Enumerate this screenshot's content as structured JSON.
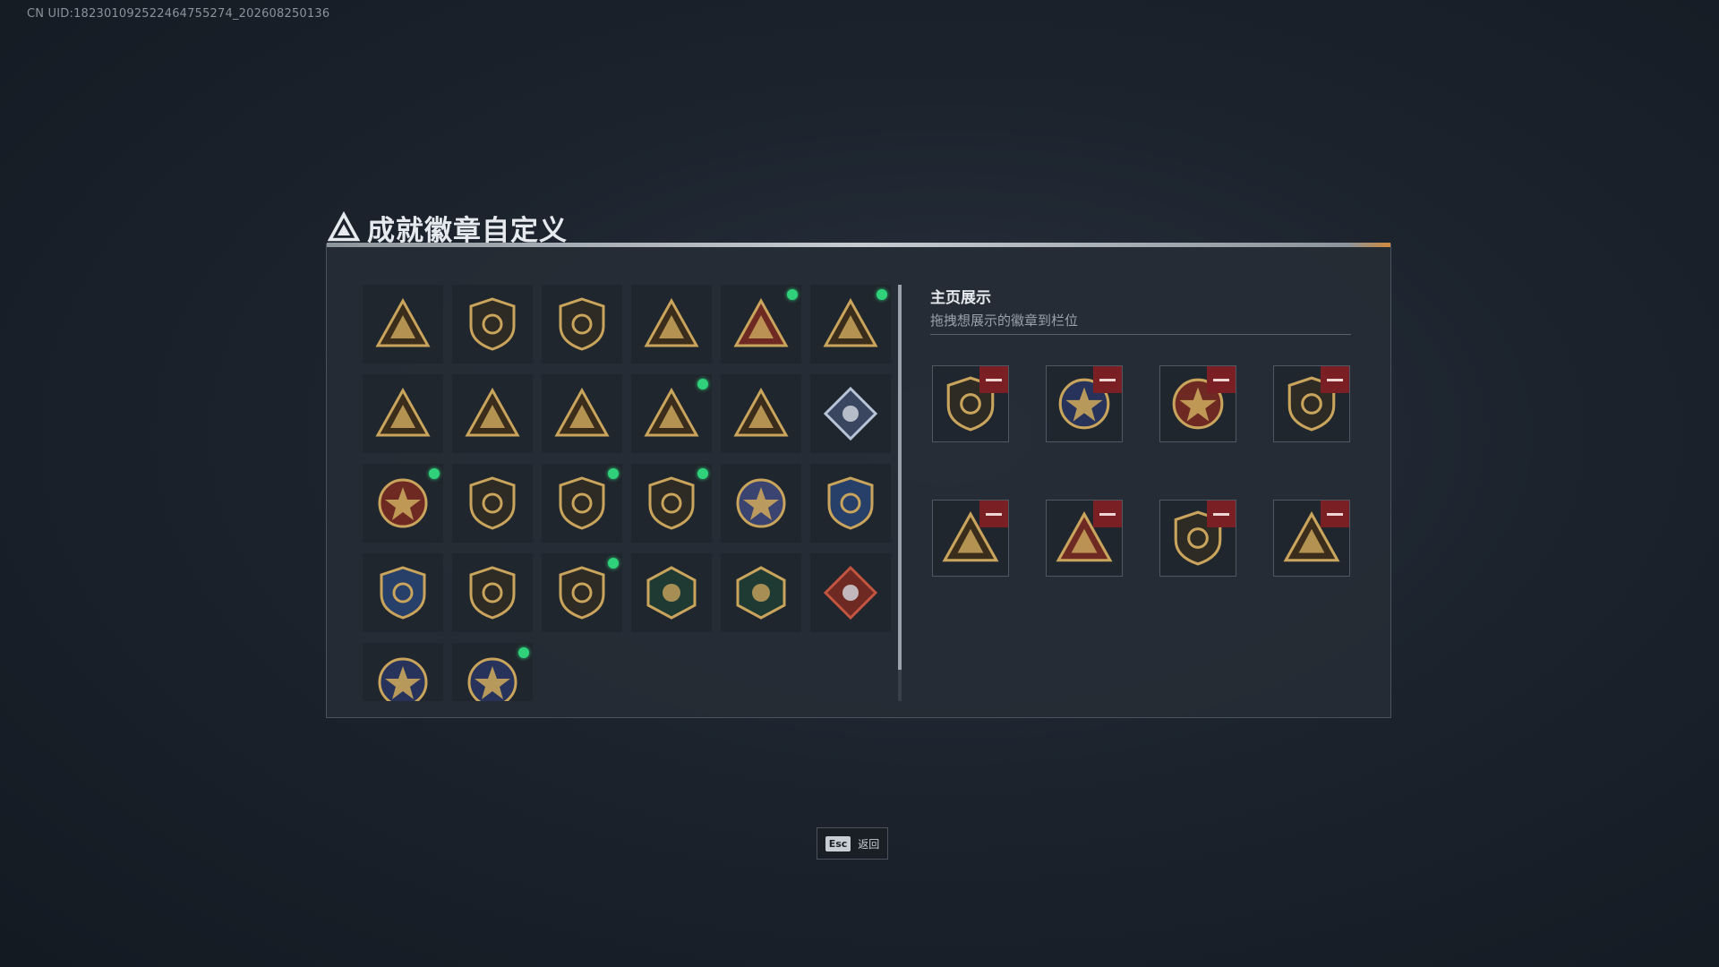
{
  "uid_text": "CN UID:182301092522464755274_202608250136",
  "title": "成就徽章自定义",
  "showcase": {
    "title": "主页展示",
    "subtitle": "拖拽想展示的徽章到栏位"
  },
  "esc": {
    "key": "Esc",
    "label": "返回"
  },
  "colors": {
    "new_dot": "#2fd17a",
    "remove_button": "#7a1f24",
    "gold": "#c9a45c",
    "navy": "#27335a",
    "dark_red": "#6e2a22"
  },
  "badges": [
    {
      "icon": "triangle-logo-badge-icon",
      "new": false
    },
    {
      "icon": "helicopter-badge-icon",
      "new": false
    },
    {
      "icon": "jet-shield-badge-icon",
      "new": false
    },
    {
      "icon": "ss-emblem-badge-icon",
      "new": false
    },
    {
      "icon": "sb-emblem-badge-icon",
      "new": true
    },
    {
      "icon": "star-emblem-badge-icon",
      "new": true
    },
    {
      "icon": "helmet-triangle-badge-icon",
      "new": false
    },
    {
      "icon": "number-one-badge-icon",
      "new": false
    },
    {
      "icon": "fist-triangle-badge-icon",
      "new": false
    },
    {
      "icon": "soldier-triangle-badge-icon",
      "new": true
    },
    {
      "icon": "rocket-triangle-badge-icon",
      "new": false
    },
    {
      "icon": "diamond-gem-badge-icon",
      "new": false
    },
    {
      "icon": "red-star-medal-icon",
      "new": true
    },
    {
      "icon": "wings-shield-badge-icon",
      "new": false
    },
    {
      "icon": "eagle-crest-badge-icon",
      "new": true
    },
    {
      "icon": "lion-shield-badge-icon",
      "new": true
    },
    {
      "icon": "skull-round-badge-icon",
      "new": false
    },
    {
      "icon": "crosshair-shield-badge-icon",
      "new": false
    },
    {
      "icon": "navy-crosshair-badge-icon",
      "new": false
    },
    {
      "icon": "sniper-shield-badge-icon",
      "new": false
    },
    {
      "icon": "gold-crest-badge-icon",
      "new": true
    },
    {
      "icon": "bird-hexagon-badge-icon",
      "new": false
    },
    {
      "icon": "gun-hexagon-badge-icon",
      "new": false
    },
    {
      "icon": "dragon-diamond-badge-icon",
      "new": false
    },
    {
      "icon": "wolf-round-badge-icon",
      "new": false
    },
    {
      "icon": "wolf-round-gold-badge-icon",
      "new": true
    }
  ],
  "slots": [
    {
      "icon": "eagle-crest-badge-icon"
    },
    {
      "icon": "wolf-round-gold-badge-icon"
    },
    {
      "icon": "red-star-medal-icon"
    },
    {
      "icon": "gold-crest-badge-icon"
    },
    {
      "icon": "soldier-triangle-badge-icon"
    },
    {
      "icon": "sb-emblem-badge-icon"
    },
    {
      "icon": "lion-shield-badge-icon"
    },
    {
      "icon": "star-emblem-badge-icon"
    }
  ]
}
